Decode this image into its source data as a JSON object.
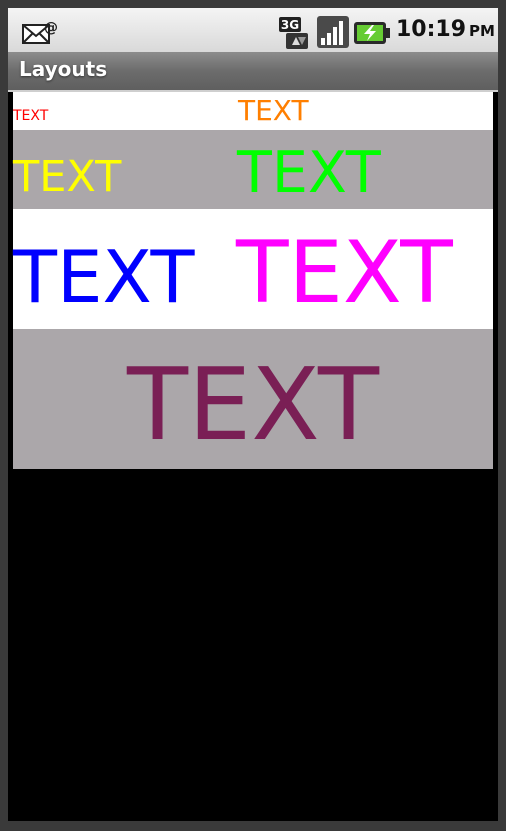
{
  "status_bar": {
    "time": "10:19",
    "ampm": "PM",
    "network_label": "3G",
    "icons": [
      "mail-notification-icon",
      "signal-3g-icon",
      "signal-bars-icon",
      "battery-charging-icon"
    ]
  },
  "title_bar": {
    "title": "Layouts"
  },
  "labels": {
    "red": "TEXT",
    "orange": "TEXT",
    "yellow": "TEXT",
    "green": "TEXT",
    "blue": "TEXT",
    "magenta": "TEXT",
    "purple": "TEXT"
  },
  "colors": {
    "red": "#ff0000",
    "orange": "#ff7f00",
    "yellow": "#ffff00",
    "green": "#00ff00",
    "blue": "#0000ff",
    "magenta": "#ff00ff",
    "purple": "#7a1f55",
    "row_white": "#ffffff",
    "row_gray": "#aba7aa",
    "screen_background": "#000000"
  }
}
